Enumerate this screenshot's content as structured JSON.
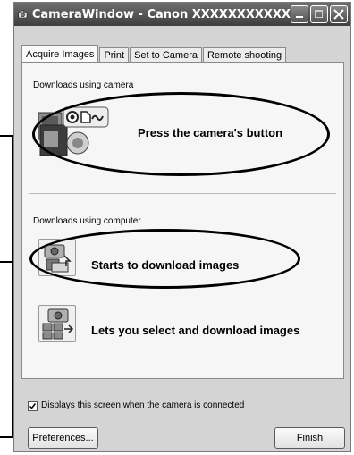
{
  "window": {
    "title": "CameraWindow - Canon XXXXXXXXXXX"
  },
  "tabs": [
    {
      "label": "Acquire Images"
    },
    {
      "label": "Print"
    },
    {
      "label": "Set to Camera"
    },
    {
      "label": "Remote shooting"
    }
  ],
  "sections": {
    "camera": {
      "label": "Downloads using camera",
      "action_label": "Press the camera's button"
    },
    "computer": {
      "label": "Downloads using computer",
      "start_label": "Starts to download images",
      "select_label": "Lets you select and download images"
    }
  },
  "footer": {
    "checkbox_label": "Displays this screen when the camera is connected",
    "checkbox_checked": true,
    "preferences_label": "Preferences...",
    "finish_label": "Finish"
  },
  "icons": {
    "app": "camera-icon",
    "camera_button": "camera-button-icon",
    "start_download": "download-icon",
    "select_download": "select-download-icon"
  }
}
